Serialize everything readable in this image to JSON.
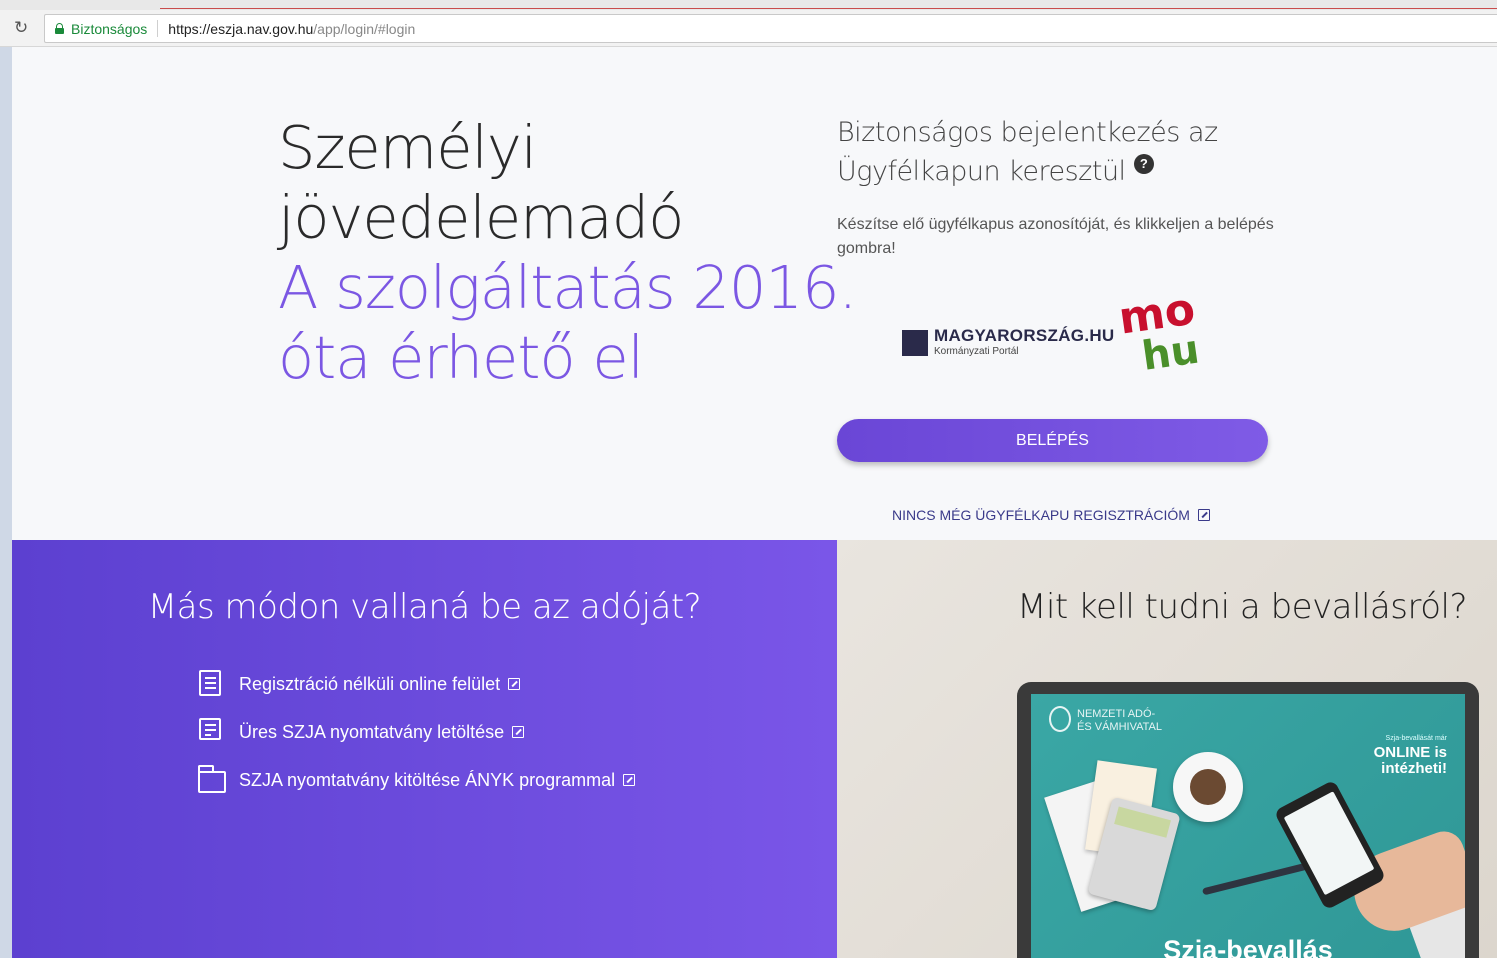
{
  "browser": {
    "reload_icon": "reload-icon",
    "secure_label": "Biztonságos",
    "url_scheme_host": "https://eszja.nav.gov.hu",
    "url_path": "/app/login/#login"
  },
  "hero": {
    "title_line1": "Személyi",
    "title_line2": "jövedelemadó",
    "accent_line1": "A szolgáltatás 2016.",
    "accent_line2": "óta érhető el",
    "accent_color": "#7b57e3"
  },
  "login": {
    "heading_line1": "Biztonságos bejelentkezés az",
    "heading_line2": "Ügyfélkapun keresztül",
    "help_glyph": "?",
    "description": "Készítse elő ügyfélkapus azonosítóját, és klikkeljen a belépés gombra!",
    "portal_name": "MAGYARORSZÁG.HU",
    "portal_sub": "Kormányzati Portál",
    "portal_badge_top": "mo",
    "portal_badge_bottom": "hu",
    "button_label": "BELÉPÉS",
    "register_link": "NINCS MÉG ÜGYFÉLKAPU REGISZTRÁCIÓM",
    "button_color": "#6f4ddc"
  },
  "alternatives": {
    "heading": "Más módon vallaná be az adóját?",
    "items": [
      {
        "label": "Regisztráció nélküli online felület",
        "icon": "document-list-icon"
      },
      {
        "label": "Üres SZJA nyomtatvány letöltése",
        "icon": "document-download-icon"
      },
      {
        "label": "SZJA nyomtatvány kitöltése ÁNYK programmal",
        "icon": "folder-icon"
      }
    ]
  },
  "info": {
    "heading": "Mit kell tudni a bevallásról?",
    "video_logo_line1": "NEMZETI ADÓ-",
    "video_logo_line2": "ÉS VÁMHIVATAL",
    "video_online_small": "Szja-bevallását már",
    "video_online_line1": "ONLINE is",
    "video_online_line2": "intézheti!",
    "video_banner": "Szja-bevallás"
  }
}
